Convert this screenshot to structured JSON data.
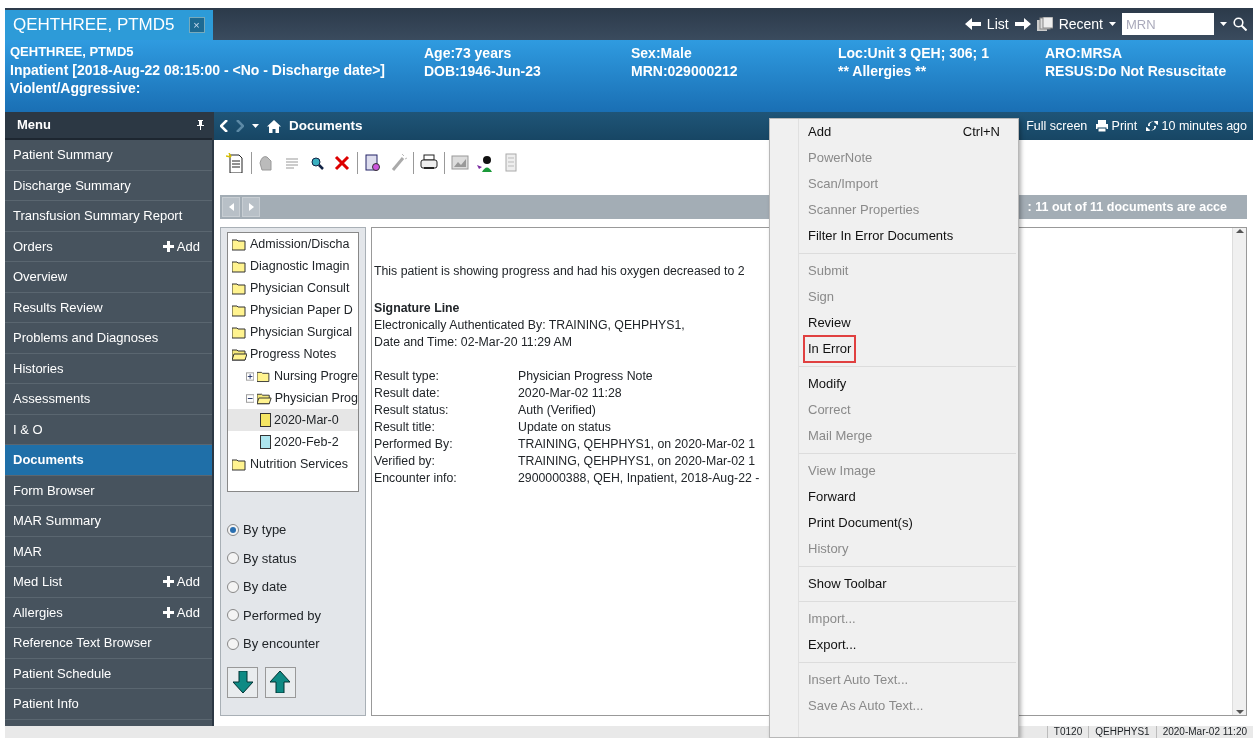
{
  "top_bar": {
    "tab": {
      "label": "QEHTHREE, PTMD5",
      "close": "×",
      "selected": true
    },
    "list_label": "List",
    "recent_label": "Recent",
    "search": {
      "placeholder": "MRN"
    }
  },
  "banner": {
    "name": "QEHTHREE, PTMD5",
    "encounter": "Inpatient [2018-Aug-22 08:15:00 - <No - Discharge date>]",
    "alert": "Violent/Aggressive:",
    "columns": [
      [
        "Age:73 years",
        "DOB:1946-Jun-23"
      ],
      [
        "Sex:Male",
        "MRN:029000212"
      ],
      [
        "Loc:Unit 3 QEH; 306; 1",
        "** Allergies **"
      ],
      [
        "ARO:MRSA",
        "RESUS:Do Not Resuscitate"
      ]
    ]
  },
  "sidebar": {
    "title": "Menu",
    "items": [
      {
        "label": "Patient Summary",
        "selected": false
      },
      {
        "label": "Discharge Summary",
        "selected": false
      },
      {
        "label": "Transfusion Summary Report",
        "selected": false
      },
      {
        "label": "Orders",
        "selected": false,
        "add": "Add"
      },
      {
        "label": "Overview",
        "selected": false
      },
      {
        "label": "Results Review",
        "selected": false
      },
      {
        "label": "Problems and Diagnoses",
        "selected": false
      },
      {
        "label": "Histories",
        "selected": false
      },
      {
        "label": "Assessments",
        "selected": false
      },
      {
        "label": "I & O",
        "selected": false
      },
      {
        "label": "Documents",
        "selected": true
      },
      {
        "label": "Form Browser",
        "selected": false
      },
      {
        "label": "MAR Summary",
        "selected": false
      },
      {
        "label": "MAR",
        "selected": false
      },
      {
        "label": "Med List",
        "selected": false,
        "add": "Add"
      },
      {
        "label": "Allergies",
        "selected": false,
        "add": "Add"
      },
      {
        "label": "Reference Text Browser",
        "selected": false
      },
      {
        "label": "Patient Schedule",
        "selected": false
      },
      {
        "label": "Patient Info",
        "selected": false
      }
    ]
  },
  "page_toolbar": {
    "title": "Documents",
    "actions": [
      "Full screen",
      "Print",
      "10 minutes ago"
    ]
  },
  "info_bar": ": 11 out of 11 documents are acce",
  "tree": [
    {
      "label": "Admission/Discha",
      "expanded": false
    },
    {
      "label": "Diagnostic Imagin",
      "expanded": false
    },
    {
      "label": "Physician Consult",
      "expanded": false
    },
    {
      "label": "Physician Paper D",
      "expanded": false
    },
    {
      "label": "Physician Surgical",
      "expanded": false
    },
    {
      "label": "Progress Notes",
      "expanded": true,
      "children": [
        {
          "label": "Nursing Progre",
          "expanded": false,
          "toggle": true
        },
        {
          "label": "Physician Prog",
          "expanded": true,
          "toggle": true,
          "children": [
            {
              "label": "2020-Mar-0",
              "kind": "doc",
              "color": "#f5e663",
              "selected": true
            },
            {
              "label": "2020-Feb-2",
              "kind": "doc",
              "color": "#aee6ef",
              "selected": false
            }
          ]
        }
      ]
    },
    {
      "label": "Nutrition Services",
      "expanded": false
    }
  ],
  "sort_options": [
    {
      "label": "By type",
      "selected": true
    },
    {
      "label": "By status",
      "selected": false
    },
    {
      "label": "By date",
      "selected": false
    },
    {
      "label": "Performed by",
      "selected": false
    },
    {
      "label": "By encounter",
      "selected": false
    }
  ],
  "document": {
    "summary": "This patient is showing progress and had his oxygen decreased to 2",
    "signature_title": "Signature Line",
    "signature_lines": [
      "Electronically Authenticated By: TRAINING, QEHPHYS1,",
      "Date and Time: 02-Mar-20 11:29 AM"
    ],
    "fields": [
      [
        "Result type:",
        "Physician Progress Note"
      ],
      [
        "Result date:",
        "2020-Mar-02 11:28"
      ],
      [
        "Result status:",
        "Auth (Verified)"
      ],
      [
        "Result title:",
        "Update on status"
      ],
      [
        "Performed By:",
        "TRAINING, QEHPHYS1, on 2020-Mar-02 1"
      ],
      [
        "Verified by:",
        "TRAINING, QEHPHYS1, on 2020-Mar-02 1"
      ],
      [
        "Encounter info:",
        "2900000388, QEH, Inpatient, 2018-Aug-22 -"
      ]
    ]
  },
  "context_menu": [
    [
      {
        "label": "Add",
        "shortcut": "Ctrl+N",
        "disabled": false,
        "highlighted": false
      },
      {
        "label": "PowerNote",
        "disabled": true,
        "highlighted": false
      },
      {
        "label": "Scan/Import",
        "disabled": true,
        "highlighted": false
      },
      {
        "label": "Scanner Properties",
        "disabled": true,
        "highlighted": false
      },
      {
        "label": "Filter In Error Documents",
        "disabled": false,
        "highlighted": false
      }
    ],
    [
      {
        "label": "Submit",
        "disabled": true,
        "highlighted": false
      },
      {
        "label": "Sign",
        "disabled": true,
        "highlighted": false
      },
      {
        "label": "Review",
        "disabled": false,
        "highlighted": false
      },
      {
        "label": "In Error",
        "disabled": false,
        "highlighted": true
      }
    ],
    [
      {
        "label": "Modify",
        "disabled": false,
        "highlighted": false
      },
      {
        "label": "Correct",
        "disabled": true,
        "highlighted": false
      },
      {
        "label": "Mail Merge",
        "disabled": true,
        "highlighted": false
      }
    ],
    [
      {
        "label": "View Image",
        "disabled": true,
        "highlighted": false
      },
      {
        "label": "Forward",
        "disabled": false,
        "highlighted": false
      },
      {
        "label": "Print Document(s)",
        "disabled": false,
        "highlighted": false
      },
      {
        "label": "History",
        "disabled": true,
        "highlighted": false
      }
    ],
    [
      {
        "label": "Show Toolbar",
        "disabled": false,
        "highlighted": false
      }
    ],
    [
      {
        "label": "Import...",
        "disabled": true,
        "highlighted": false
      },
      {
        "label": "Export...",
        "disabled": false,
        "highlighted": false
      }
    ],
    [
      {
        "label": "Insert Auto Text...",
        "disabled": true,
        "highlighted": false
      },
      {
        "label": "Save As Auto Text...",
        "disabled": true,
        "highlighted": false
      }
    ]
  ],
  "status_bar": [
    "T0120",
    "QEHPHYS1",
    "2020-Mar-02 11:20"
  ]
}
